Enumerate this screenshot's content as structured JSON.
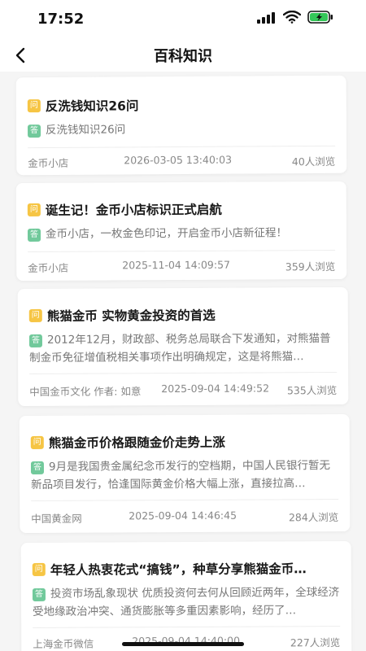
{
  "status": {
    "time": "17:52"
  },
  "header": {
    "title": "百科知识"
  },
  "badges": {
    "q": "问",
    "a": "答"
  },
  "articles": [
    {
      "question": "反洗钱知识26问",
      "answer": "反洗钱知识26问",
      "source": "金币小店",
      "datetime": "2026-03-05 13:40:03",
      "views": "40人浏览"
    },
    {
      "question": "诞生记！金币小店标识正式启航",
      "answer": "金币小店，一枚金色印记，开启金币小店新征程！",
      "source": "金币小店",
      "datetime": "2025-11-04 14:09:57",
      "views": "359人浏览"
    },
    {
      "question": "熊猫金币 实物黄金投资的首选",
      "answer": "2012年12月，财政部、税务总局联合下发通知，对熊猫普制金币免征增值税相关事项作出明确规定，这是将熊猫…",
      "source": "中国金币文化 作者: 如意",
      "datetime": "2025-09-04 14:49:52",
      "views": "535人浏览"
    },
    {
      "question": "熊猫金币价格跟随金价走势上涨",
      "answer": "9月是我国贵金属纪念币发行的空档期，中国人民银行暂无新品项目发行，恰逢国际黄金价格大幅上涨，直接拉高…",
      "source": "中国黄金网",
      "datetime": "2025-09-04 14:46:45",
      "views": "284人浏览"
    },
    {
      "question": "年轻人热衷花式“搞钱”，种草分享熊猫金币…",
      "answer": "投资市场乱象现状 优质投资何去何从回顾近两年，全球经济受地缘政治冲突、通货膨胀等多重因素影响，经历了…",
      "source": "上海金币微信",
      "datetime": "2025-09-04 14:40:00",
      "views": "227人浏览"
    }
  ]
}
